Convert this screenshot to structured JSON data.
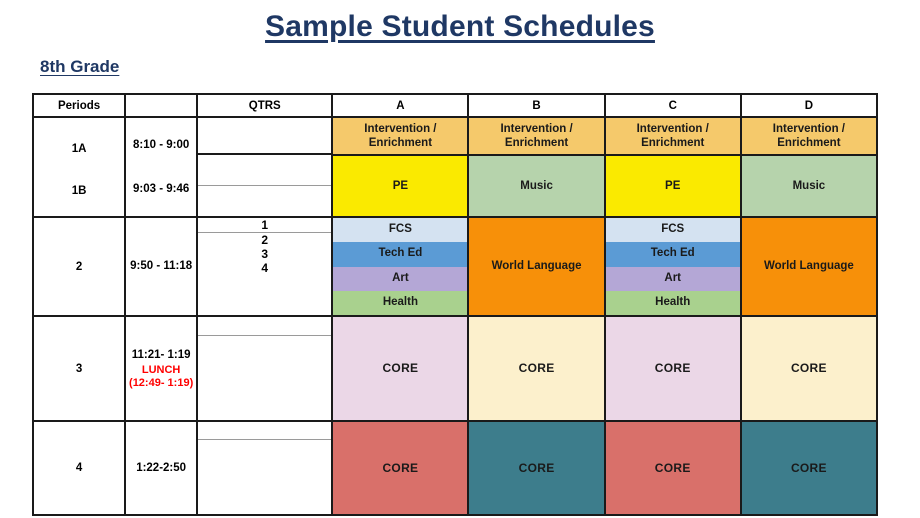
{
  "title": "Sample Student Schedules",
  "grade": "8th Grade",
  "colors": {
    "title_blue": "#1F3864",
    "intervention": "#F5C96B",
    "pe_yellow": "#FAEA00",
    "music_green": "#B6D3AC",
    "fcs_blue": "#D4E2F1",
    "techEd_blue": "#5B9BD5",
    "art_purple": "#B4A7D6",
    "health_green": "#A9D18E",
    "world_language_orange": "#F79009",
    "core_pink": "#EBD7E7",
    "core_cream": "#FCF0CC",
    "core_salmon": "#D9706A",
    "core_teal": "#3D7D8C",
    "lunch_red": "#FF0000"
  },
  "table": {
    "headers": {
      "periods": "Periods",
      "time": "",
      "qtrs": "QTRS",
      "a": "A",
      "b": "B",
      "c": "C",
      "d": "D"
    },
    "rows": [
      {
        "period_top": "1A",
        "period_bottom": "1B",
        "time_top": "8:10 - 9:00",
        "time_bottom": "9:03 - 9:46",
        "qtrs": [
          "",
          ""
        ],
        "cells_top": [
          {
            "label": "Intervention / Enrichment",
            "color": "#F5C96B"
          },
          {
            "label": "Intervention / Enrichment",
            "color": "#F5C96B"
          },
          {
            "label": "Intervention / Enrichment",
            "color": "#F5C96B"
          },
          {
            "label": "Intervention / Enrichment",
            "color": "#F5C96B"
          }
        ],
        "cells_bottom": [
          {
            "label": "PE",
            "color": "#FAEA00"
          },
          {
            "label": "Music",
            "color": "#B6D3AC"
          },
          {
            "label": "PE",
            "color": "#FAEA00"
          },
          {
            "label": "Music",
            "color": "#B6D3AC"
          }
        ]
      },
      {
        "period": "2",
        "time": "9:50 - 11:18",
        "qtrs": [
          "1",
          "2",
          "3",
          "4"
        ],
        "columns": [
          {
            "split": true,
            "blocks": [
              {
                "label": "FCS",
                "color": "#D4E2F1"
              },
              {
                "label": "Tech Ed",
                "color": "#5B9BD5"
              },
              {
                "label": "Art",
                "color": "#B4A7D6"
              },
              {
                "label": "Health",
                "color": "#A9D18E"
              }
            ]
          },
          {
            "split": false,
            "label": "World Language",
            "color": "#F79009"
          },
          {
            "split": true,
            "blocks": [
              {
                "label": "FCS",
                "color": "#D4E2F1"
              },
              {
                "label": "Tech Ed",
                "color": "#5B9BD5"
              },
              {
                "label": "Art",
                "color": "#B4A7D6"
              },
              {
                "label": "Health",
                "color": "#A9D18E"
              }
            ]
          },
          {
            "split": false,
            "label": "World Language",
            "color": "#F79009"
          }
        ]
      },
      {
        "period": "3",
        "time": "11:21- 1:19",
        "lunch": "LUNCH (12:49- 1:19)",
        "qtrs": [
          "",
          ""
        ],
        "columns": [
          {
            "split": false,
            "label": "CORE",
            "color": "#EBD7E7"
          },
          {
            "split": false,
            "label": "CORE",
            "color": "#FCF0CC"
          },
          {
            "split": false,
            "label": "CORE",
            "color": "#EBD7E7"
          },
          {
            "split": false,
            "label": "CORE",
            "color": "#FCF0CC"
          }
        ]
      },
      {
        "period": "4",
        "time": "1:22-2:50",
        "qtrs": [
          "",
          ""
        ],
        "columns": [
          {
            "split": false,
            "label": "CORE",
            "color": "#D9706A"
          },
          {
            "split": false,
            "label": "CORE",
            "color": "#3D7D8C"
          },
          {
            "split": false,
            "label": "CORE",
            "color": "#D9706A"
          },
          {
            "split": false,
            "label": "CORE",
            "color": "#3D7D8C"
          }
        ]
      }
    ]
  }
}
